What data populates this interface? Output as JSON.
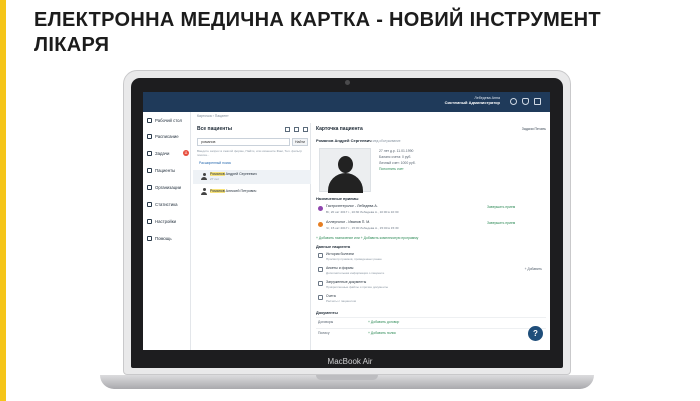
{
  "slide": {
    "title_line1": "ЕЛЕКТРОННА МЕДИЧНА КАРТКА - НОВИЙ ІНСТРУМЕНТ",
    "title_line2": "ЛІКАРЯ",
    "accent_color": "#f5c518"
  },
  "laptop": {
    "brand": "MacBook Air"
  },
  "app": {
    "user": {
      "name": "Лебедева Анна",
      "role": "Системный Администратор"
    },
    "breadcrumb": "Карточка › Пациент",
    "sidebar": [
      {
        "label": "Рабочий стол",
        "icon": "desk-icon"
      },
      {
        "label": "Расписание",
        "icon": "calendar-icon"
      },
      {
        "label": "Задачи",
        "icon": "tasks-icon",
        "badge": "11"
      },
      {
        "label": "Пациенты",
        "icon": "patients-icon"
      },
      {
        "label": "Организации",
        "icon": "organizations-icon"
      },
      {
        "label": "Статистика",
        "icon": "statistics-icon"
      },
      {
        "label": "Настройки",
        "icon": "settings-icon"
      },
      {
        "label": "Помощь",
        "icon": "help-icon"
      }
    ],
    "patients": {
      "title": "Все пациенты",
      "search_value": "романов",
      "search_button": "Найти",
      "hint": "Введите запрос в сжатой форме, Найти, или измените Фам, Тел. фильтр поиска...",
      "extended_search": "Расширенный поиск",
      "list": [
        {
          "highlight": "Романов",
          "rest": " Андрей Сергеевич",
          "age": "27 лет"
        },
        {
          "highlight": "Романов",
          "rest": " Алексей Петрович",
          "age": ""
        }
      ]
    },
    "card": {
      "title": "Карточка пациента",
      "actions": "Задачи   Печать",
      "patient_name": "Романов Андрей Сергеевич",
      "patient_tag": "мед.обслуживание",
      "info": [
        "27 лет д.р. 11.01.1990",
        "Баланс счета: 0 руб.",
        "Личный счет: 1000 руб.",
        "Пополнить счет"
      ],
      "appointments_header": "Назначенные приемы",
      "appointments": [
        {
          "title": "Гастроэнтеролог - Лебедева А.",
          "sub": "Вт, 20 окт 2017 г., 10:30  Лебедева А., 10:00 в 10:30",
          "done": "Завершить прием",
          "color": "#8e44ad"
        },
        {
          "title": "Аллерголог - Иванов П. М.",
          "sub": "Чт, 15 окт 2017 г., 15:00  Лебедева А., 15:00 в 15:30",
          "done": "Завершить прием",
          "color": "#e67e22"
        }
      ],
      "add_links": "+ Добавить назначение или  + Добавить комплексную программу",
      "data_header": "Данные пациента",
      "data_items": [
        {
          "title": "История болезни",
          "sub": "Просмотр приемов, проведенных ранее",
          "action": ""
        },
        {
          "title": "Анкеты и формы",
          "sub": "Дополнительная информация о пациенте",
          "action": "+ Добавить"
        },
        {
          "title": "Загруженные документы",
          "sub": "Прикрепленные файлы и прочие документы",
          "action": ""
        },
        {
          "title": "Счета",
          "sub": "Расчеты с пациентом",
          "action": ""
        }
      ],
      "docs_header": "Документы",
      "docs": [
        {
          "key": "Договоры",
          "value": "+ Добавить договор"
        },
        {
          "key": "Полису",
          "value": "+ Добавить полис"
        }
      ]
    },
    "help_button": "?"
  }
}
